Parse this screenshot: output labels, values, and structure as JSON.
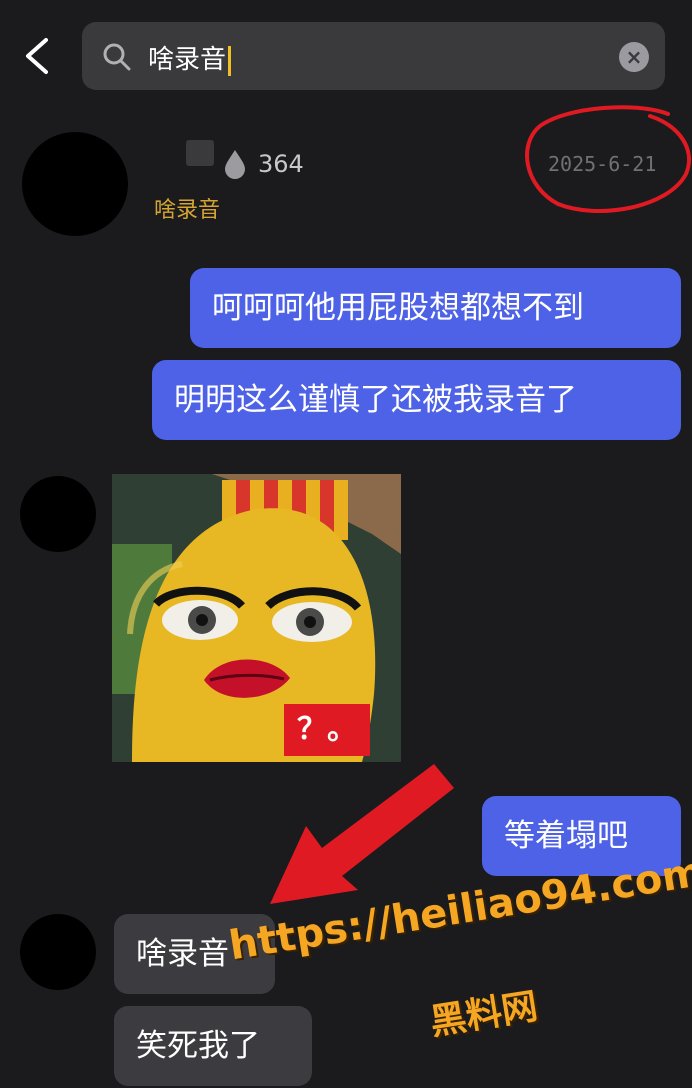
{
  "search": {
    "query": "啥录音"
  },
  "contact": {
    "count": "364",
    "name": "啥录音",
    "date": "2025-6-21"
  },
  "messages": {
    "out_1": "呵呵呵他用屁股想都想不到",
    "out_2": "明明这么谨慎了还被我录音了",
    "sticker_text": "？。",
    "out_3": "等着塌吧",
    "in_1": "啥录音",
    "in_2": "笑死我了"
  },
  "watermark": {
    "url": "https://heiliao94.com",
    "name": "黑料网"
  },
  "colors": {
    "outgoing_bubble": "#4d62e6",
    "incoming_bubble": "#3c3c40",
    "accent_name": "#d4a531",
    "annotation": "#e01a22",
    "watermark": "#f5a623"
  },
  "icons": [
    "back-chevron-icon",
    "search-icon",
    "clear-icon",
    "like-drop-icon"
  ]
}
